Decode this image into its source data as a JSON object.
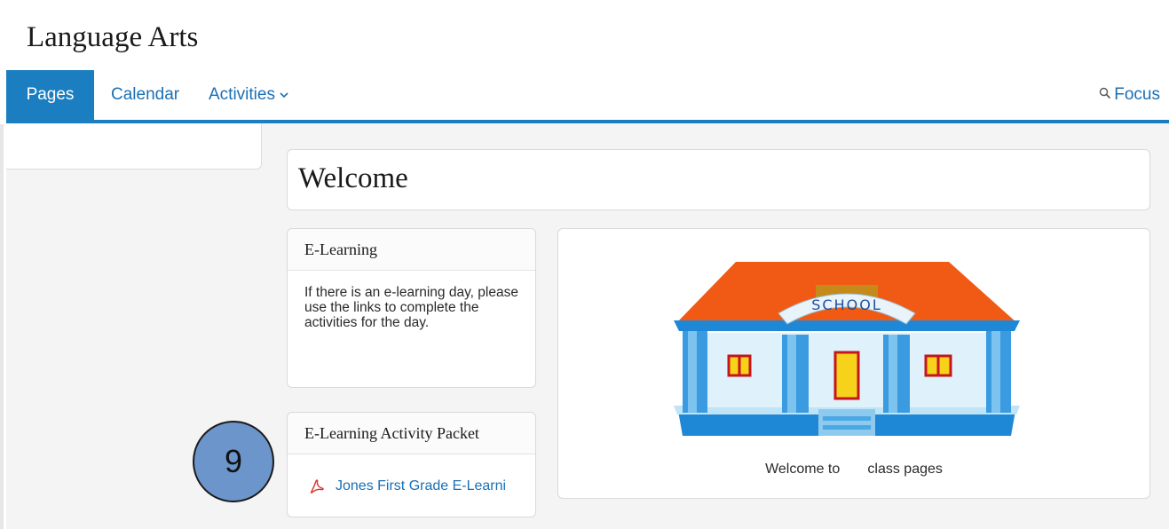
{
  "site": {
    "title": "Language Arts"
  },
  "nav": {
    "tabs": [
      {
        "label": "Pages",
        "active": true
      },
      {
        "label": "Calendar",
        "active": false
      },
      {
        "label": "Activities",
        "active": false,
        "has_dropdown": true
      }
    ],
    "focus_label": "Focus",
    "focus_icon": "search-icon",
    "accent_color": "#1a7ec1"
  },
  "main": {
    "welcome_title": "Welcome",
    "elearning_card": {
      "heading": "E-Learning",
      "body": "If there is an e-learning day, please use the links to complete the activities for the day."
    },
    "packet_card": {
      "heading": "E-Learning Activity Packet",
      "file_link": "Jones First Grade E-Learni",
      "file_icon": "pdf-icon"
    },
    "image_card": {
      "sign_text": "SCHOOL",
      "caption": "Welcome to       class pages"
    }
  },
  "overlay": {
    "step_number": "9"
  }
}
